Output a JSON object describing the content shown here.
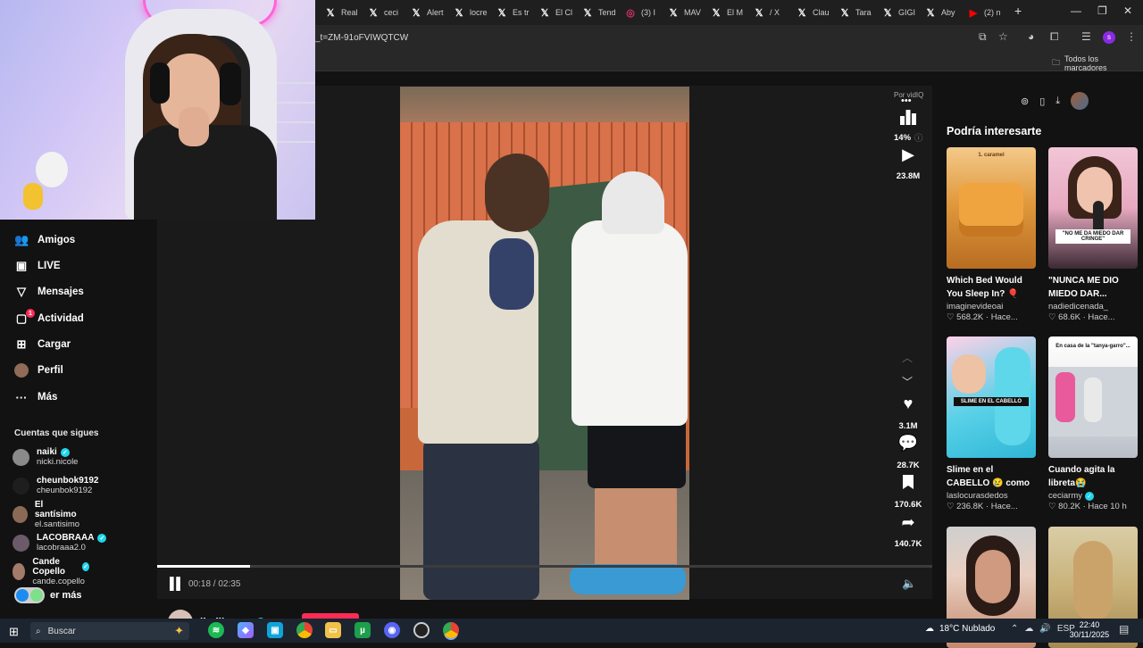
{
  "browser": {
    "tabs": [
      {
        "icon": "x-logo-icon",
        "label": "Real"
      },
      {
        "icon": "x-logo-icon",
        "label": "ceci"
      },
      {
        "icon": "x-logo-icon",
        "label": "Alert"
      },
      {
        "icon": "x-logo-icon",
        "label": "locre"
      },
      {
        "icon": "x-logo-icon",
        "label": "Es tr"
      },
      {
        "icon": "x-logo-icon",
        "label": "El Cl"
      },
      {
        "icon": "x-logo-icon",
        "label": "Tend"
      },
      {
        "icon": "instagram-icon",
        "label": "(3) I"
      },
      {
        "icon": "x-logo-icon",
        "label": "MAV"
      },
      {
        "icon": "x-logo-icon",
        "label": "El M"
      },
      {
        "icon": "x-logo-icon",
        "label": "/ X"
      },
      {
        "icon": "x-logo-icon",
        "label": "Clau"
      },
      {
        "icon": "x-logo-icon",
        "label": "Tara"
      },
      {
        "icon": "x-logo-icon",
        "label": "GIGI"
      },
      {
        "icon": "x-logo-icon",
        "label": "Aby"
      },
      {
        "icon": "youtube-icon",
        "label": "(2) n"
      }
    ],
    "new_tab": "+",
    "url": "_t=ZM-91oFVIWQTCW",
    "all_bookmarks": "Todos los marcadores"
  },
  "nav": {
    "items": [
      {
        "icon": "friends-icon",
        "glyph": "👥",
        "label": "Amigos"
      },
      {
        "icon": "live-icon",
        "glyph": "▣",
        "label": "LIVE"
      },
      {
        "icon": "messages-icon",
        "glyph": "▽",
        "label": "Mensajes"
      },
      {
        "icon": "activity-icon",
        "glyph": "▢",
        "label": "Actividad"
      },
      {
        "icon": "upload-icon",
        "glyph": "⊞",
        "label": "Cargar"
      },
      {
        "icon": "profile-icon",
        "glyph": "●",
        "label": "Perfil"
      },
      {
        "icon": "more-icon",
        "glyph": "···",
        "label": "Más"
      }
    ],
    "activity_badge": "1"
  },
  "following": {
    "title": "Cuentas que sigues",
    "accounts": [
      {
        "name": "naiki",
        "handle": "nicki.nicole",
        "verified": true,
        "color": "#8a8a8a"
      },
      {
        "name": "cheunbok9192",
        "handle": "cheunbok9192",
        "verified": false,
        "color": "#1e1e1e"
      },
      {
        "name": "El santísimo",
        "handle": "el.santisimo",
        "verified": false,
        "color": "#8b6a55"
      },
      {
        "name": "LACOBRAAA",
        "handle": "lacobraaa2.0",
        "verified": true,
        "color": "#6b5b6a"
      },
      {
        "name": "Cande Copello",
        "handle": "cande.copello",
        "verified": true,
        "color": "#a37b6b"
      }
    ],
    "see_more": "er más"
  },
  "player": {
    "time": "00:18 / 02:35",
    "progress": 0.12,
    "vidiq_by": "Por vidIQ",
    "vidiq_percent": "14%",
    "views": "23.8M",
    "likes": "3.1M",
    "comments": "28.7K",
    "saves": "170.6K",
    "shares": "140.7K"
  },
  "creator": {
    "name": "ibaillanos"
  },
  "recommendations": {
    "title": "Podría interesarte",
    "cards": [
      {
        "title": "Which Bed Would You Sleep In? 🎈⛓...",
        "author": "imaginevideoai",
        "verified": false,
        "meta": "♡ 568.2K · Hace...",
        "thumb_text": "1. caramel",
        "bg": "linear-gradient(180deg,#f3c98a 0%,#e19a3e 45%,#b86d22 100%)",
        "text_color": "#6b3a10"
      },
      {
        "title": "\"NUNCA ME DIO MIEDO DAR...",
        "author": "nadiedicenada_",
        "verified": false,
        "meta": "♡ 68.6K · Hace...",
        "thumb_text": "\"NO ME DA MIEDO DAR CRINGE\"",
        "bg": "linear-gradient(180deg,#f1c6d6 0%,#e7a9c0 50%,#3b2a33 100%)",
        "text_color": "#111"
      },
      {
        "title": "Slime en el CABELLO 😢 como me saco ...",
        "author": "laslocurasdedos",
        "verified": false,
        "meta": "♡ 236.8K · Hace...",
        "thumb_text": "SLIME EN EL CABELLO",
        "bg": "linear-gradient(160deg,#ffd1e8 0%,#59d1e8 55%,#2fb7d6 100%)",
        "text_color": "#fff"
      },
      {
        "title": "Cuando agita la libreta😭",
        "author": "ceciarmy",
        "verified": true,
        "meta": "♡ 80.2K · Hace 10 h",
        "thumb_text": "En casa de la \"tanya-garro\"...",
        "bg": "linear-gradient(180deg,#ffffff 0%,#f2f2f2 30%,#d7d9df 60%,#b9bec7 100%)",
        "text_color": "#111"
      },
      {
        "title": "",
        "author": "",
        "verified": false,
        "meta": "",
        "thumb_text": "",
        "bg": "linear-gradient(180deg,#cfcfcf 0%,#e9cfc1 40%,#c5896d 100%)",
        "text_color": "#111"
      },
      {
        "title": "",
        "author": "",
        "verified": false,
        "meta": "",
        "thumb_text": "",
        "bg": "linear-gradient(180deg,#d9cda7 0%,#c9b27a 50%,#a48a50 100%)",
        "text_color": "#111"
      }
    ]
  },
  "taskbar": {
    "search_placeholder": "Buscar",
    "weather": "18°C  Nublado",
    "lang": "ESP",
    "time": "22:40",
    "date": "30/11/2025"
  }
}
